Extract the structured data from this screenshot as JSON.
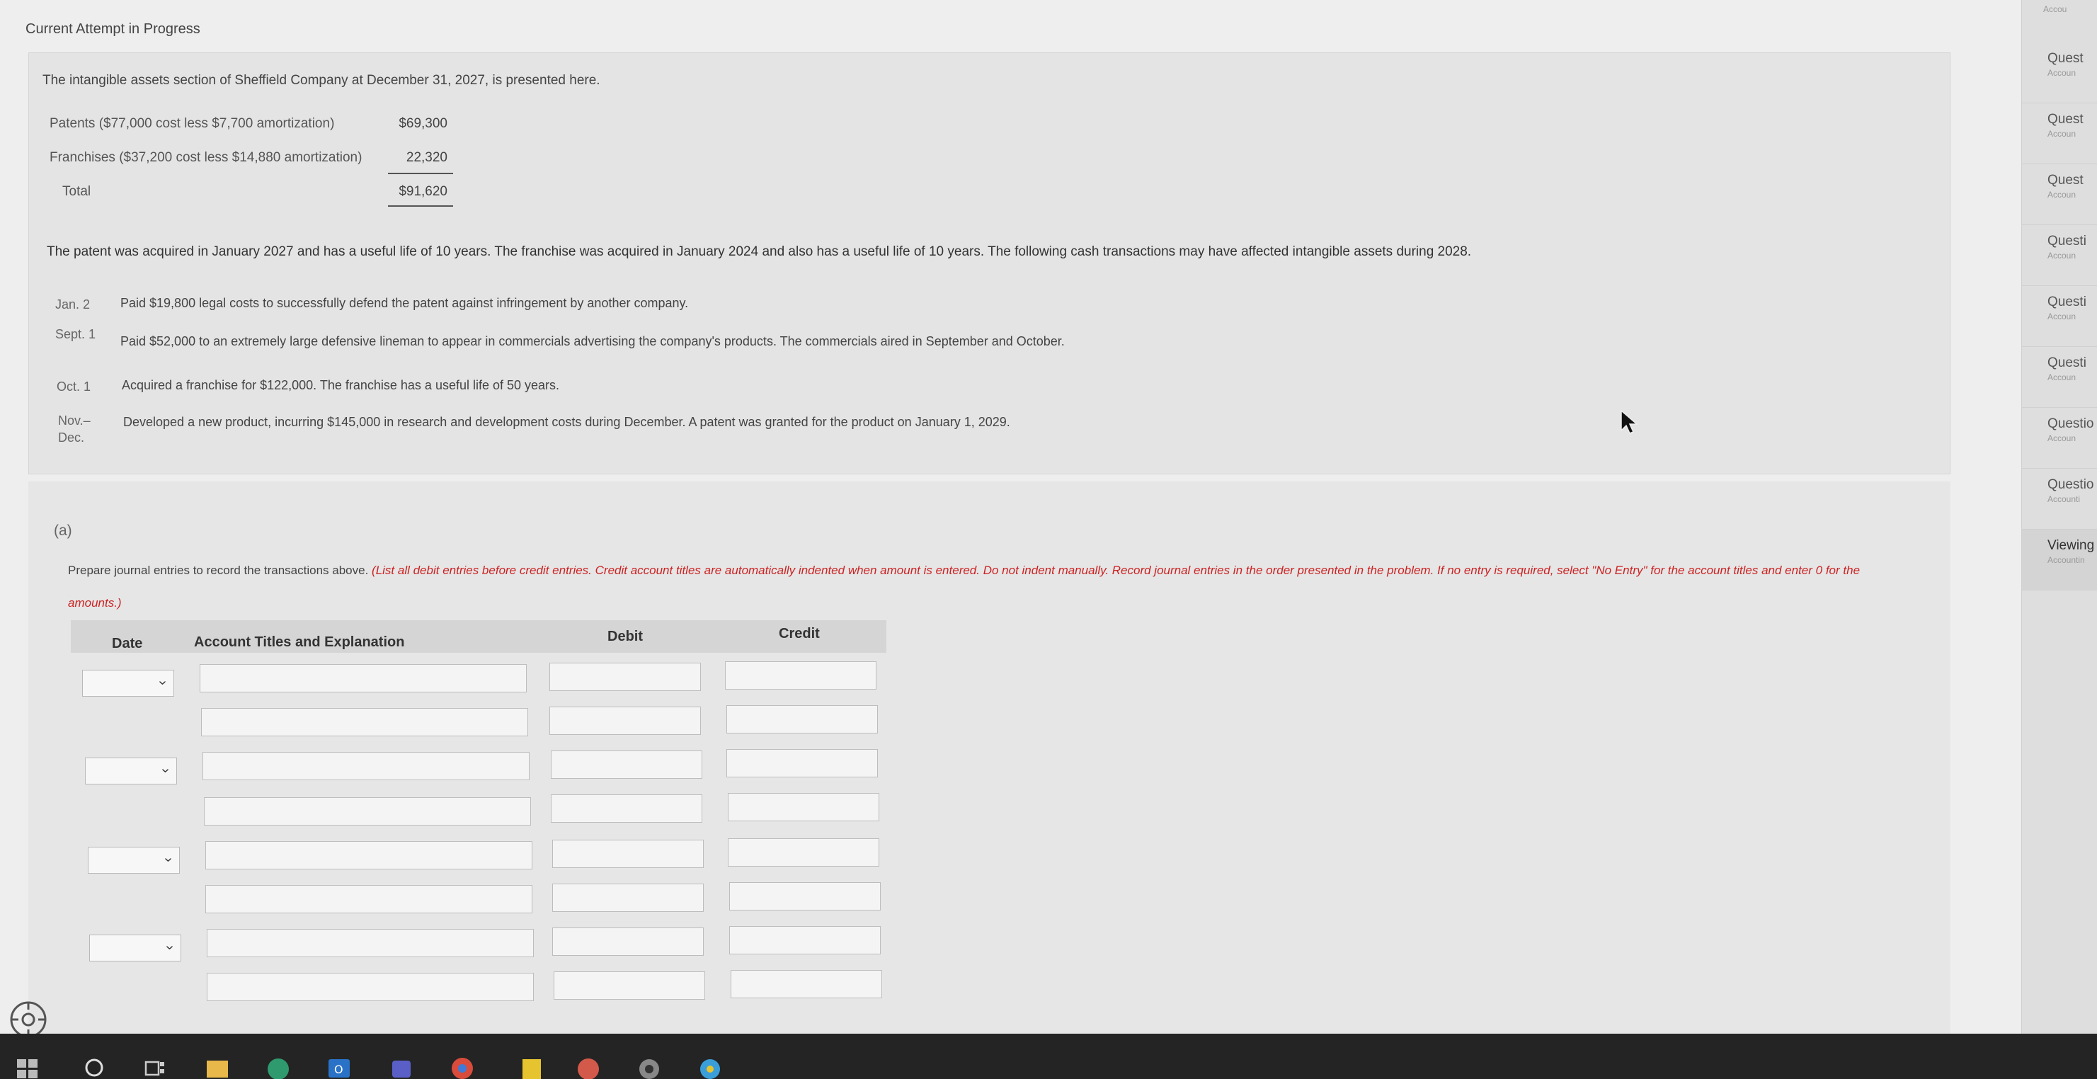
{
  "header": {
    "attempt_label": "Current Attempt in Progress"
  },
  "problem": {
    "intro": "The intangible assets section of Sheffield Company at December 31, 2027, is presented here.",
    "assets": [
      {
        "label": "Patents ($77,000 cost less $7,700 amortization)",
        "amount": "$69,300"
      },
      {
        "label": "Franchises ($37,200 cost less $14,880 amortization)",
        "amount": "22,320"
      },
      {
        "label": "Total",
        "amount": "$91,620"
      }
    ],
    "paragraph": "The patent was acquired in January 2027 and has a useful life of 10 years. The franchise was acquired in January 2024 and also has a useful life of 10 years. The following cash transactions may have affected intangible assets during 2028.",
    "transactions": [
      {
        "date": "Jan. 2",
        "desc": "Paid $19,800 legal costs to successfully defend the patent against infringement by another company."
      },
      {
        "date": "Sept. 1",
        "desc": "Paid $52,000 to an extremely large defensive lineman to appear in commercials advertising the company's products. The commercials aired in September and October."
      },
      {
        "date": "Oct. 1",
        "desc": "Acquired a franchise for $122,000. The franchise has a useful life of 50 years."
      },
      {
        "date": "Nov.–Dec.",
        "desc": "Developed a new product, incurring $145,000 in research and development costs during December. A patent was granted for the product on January 1, 2029."
      }
    ]
  },
  "part_a": {
    "label": "(a)",
    "instruction_plain": "Prepare journal entries to record the transactions above. ",
    "instruction_red": "(List all debit entries before credit entries. Credit account titles are automatically indented when amount is entered. Do not indent manually. Record journal entries in the order presented in the problem. If no entry is required, select \"No Entry\" for the account titles and enter 0 for the",
    "instruction_red_2": "amounts.)",
    "table": {
      "headers": {
        "date": "Date",
        "account": "Account Titles and Explanation",
        "debit": "Debit",
        "credit": "Credit"
      }
    }
  },
  "sidebar": {
    "top_label": "Accou",
    "items": [
      {
        "title": "Quest",
        "sub": "Accoun"
      },
      {
        "title": "Quest",
        "sub": "Accoun"
      },
      {
        "title": "Quest",
        "sub": "Accoun"
      },
      {
        "title": "Questi",
        "sub": "Accoun"
      },
      {
        "title": "Questi",
        "sub": "Accoun"
      },
      {
        "title": "Questi",
        "sub": "Accoun"
      },
      {
        "title": "Questio",
        "sub": "Accoun"
      },
      {
        "title": "Questio",
        "sub": "Accounti"
      },
      {
        "title": "Viewing",
        "sub": "Accountin"
      }
    ]
  },
  "taskbar": {
    "icons": [
      "windows-icon",
      "search-icon",
      "task-view-icon",
      "file-explorer-icon",
      "edge-icon",
      "outlook-icon",
      "teams-icon",
      "chrome-icon",
      "sticky-notes-icon",
      "app-icon",
      "camera-icon",
      "chrome-beta-icon"
    ]
  },
  "colors": {
    "accent_red": "#c22222",
    "panel": "#e4e4e4",
    "taskbar": "#242424"
  }
}
